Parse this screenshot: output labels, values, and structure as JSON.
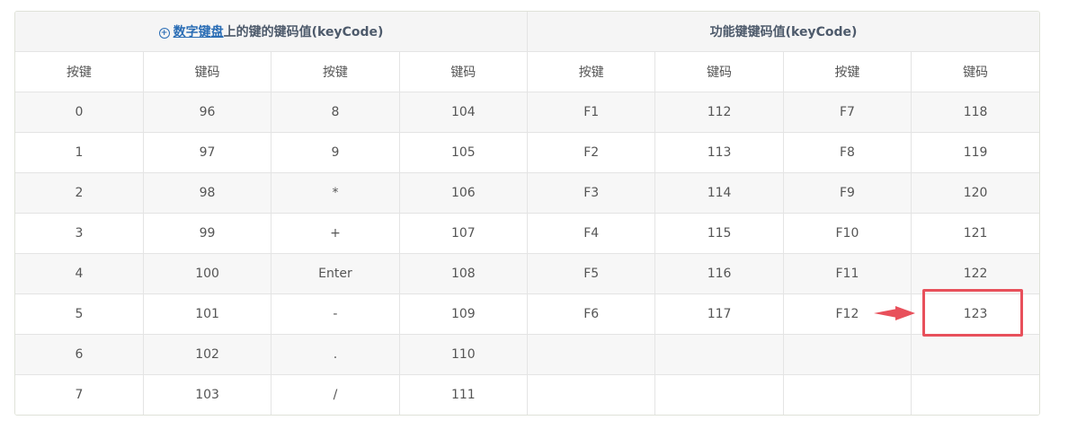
{
  "header": {
    "left_group_link": "数字键盘",
    "left_group_rest": "上的键的键码值(keyCode)",
    "right_group": "功能键键码值(keyCode)",
    "columns": [
      "按键",
      "键码",
      "按键",
      "键码",
      "按键",
      "键码",
      "按键",
      "键码"
    ]
  },
  "rows": [
    [
      "0",
      "96",
      "8",
      "104",
      "F1",
      "112",
      "F7",
      "118"
    ],
    [
      "1",
      "97",
      "9",
      "105",
      "F2",
      "113",
      "F8",
      "119"
    ],
    [
      "2",
      "98",
      "*",
      "106",
      "F3",
      "114",
      "F9",
      "120"
    ],
    [
      "3",
      "99",
      "+",
      "107",
      "F4",
      "115",
      "F10",
      "121"
    ],
    [
      "4",
      "100",
      "Enter",
      "108",
      "F5",
      "116",
      "F11",
      "122"
    ],
    [
      "5",
      "101",
      "-",
      "109",
      "F6",
      "117",
      "F12",
      "123"
    ],
    [
      "6",
      "102",
      ".",
      "110",
      "",
      "",
      "",
      ""
    ],
    [
      "7",
      "103",
      "/",
      "111",
      "",
      "",
      "",
      ""
    ]
  ],
  "colors": {
    "header_bg": "#f5f5f5",
    "stripe_bg": "#f7f7f7",
    "border": "#e4e4e4",
    "link": "#2a6db5",
    "highlight": "#e8505b"
  }
}
